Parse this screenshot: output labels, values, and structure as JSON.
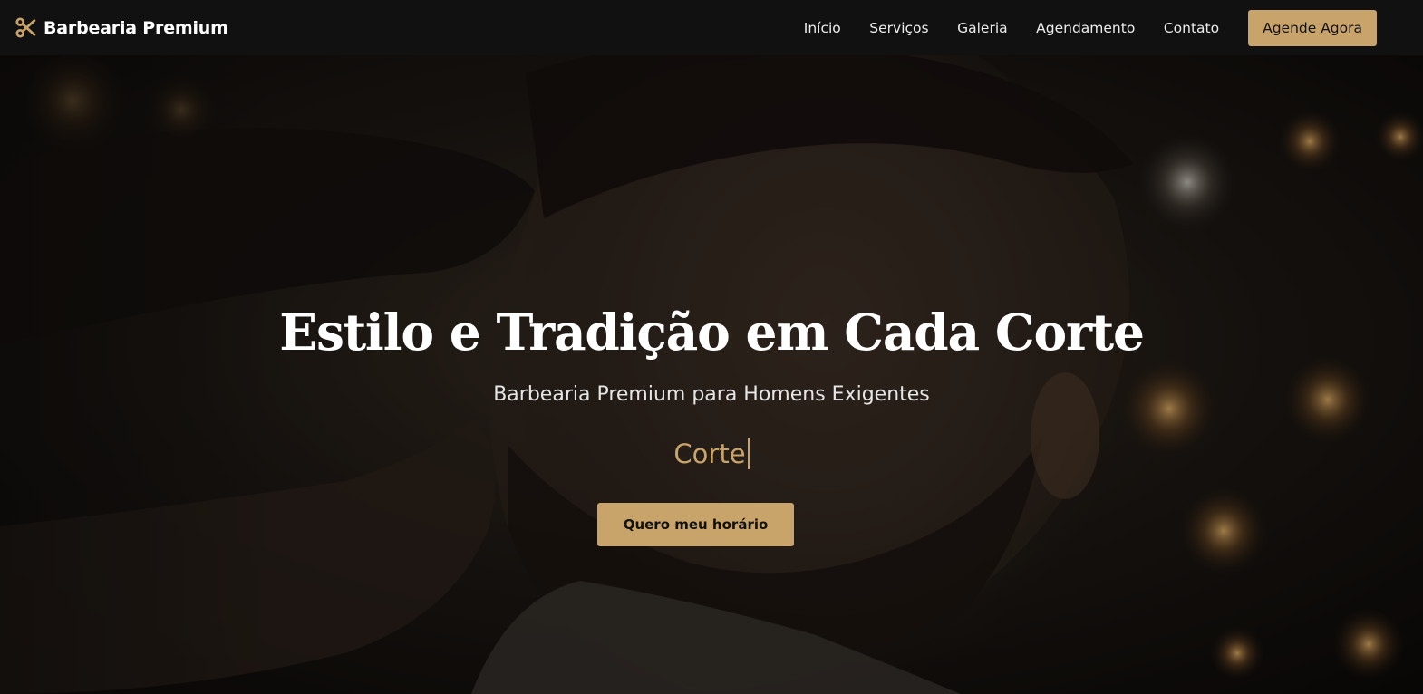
{
  "header": {
    "brand_icon": "scissors-icon",
    "brand_name": "Barbearia Premium",
    "nav": [
      {
        "label": "Início"
      },
      {
        "label": "Serviços"
      },
      {
        "label": "Galeria"
      },
      {
        "label": "Agendamento"
      },
      {
        "label": "Contato"
      }
    ],
    "cta_label": "Agende Agora"
  },
  "hero": {
    "title": "Estilo e Tradição em Cada Corte",
    "subtitle": "Barbearia Premium para Homens Exigentes",
    "typed_text": "Corte",
    "button_label": "Quero meu horário"
  },
  "colors": {
    "accent": "#c9a46a",
    "header_bg": "#111111",
    "text": "#ffffff"
  }
}
